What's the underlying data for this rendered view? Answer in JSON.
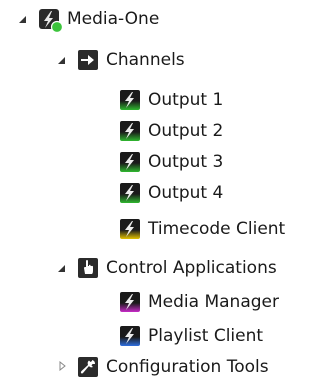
{
  "tree": {
    "root": {
      "label": "Media-One",
      "icon": "media-one-app-icon",
      "expanded": true,
      "status_color": "#3cc43c"
    },
    "channels": {
      "label": "Channels",
      "icon": "channels-arrow-icon",
      "expanded": true,
      "items": [
        {
          "label": "Output 1",
          "icon": "output-flash-icon",
          "color": "#2fb82f"
        },
        {
          "label": "Output 2",
          "icon": "output-flash-icon",
          "color": "#2fb82f"
        },
        {
          "label": "Output 3",
          "icon": "output-flash-icon",
          "color": "#2fb82f"
        },
        {
          "label": "Output 4",
          "icon": "output-flash-icon",
          "color": "#2fb82f"
        },
        {
          "label": "Timecode Client",
          "icon": "timecode-flash-icon",
          "color": "#e6c400"
        }
      ]
    },
    "control_apps": {
      "label": "Control Applications",
      "icon": "hand-pointer-icon",
      "expanded": true,
      "items": [
        {
          "label": "Media Manager",
          "icon": "media-manager-flash-icon",
          "color": "#c82ac8"
        },
        {
          "label": "Playlist Client",
          "icon": "playlist-flash-icon",
          "color": "#2f6fe0"
        }
      ]
    },
    "config_tools": {
      "label": "Configuration Tools",
      "icon": "wrench-icon",
      "expanded": false
    }
  }
}
